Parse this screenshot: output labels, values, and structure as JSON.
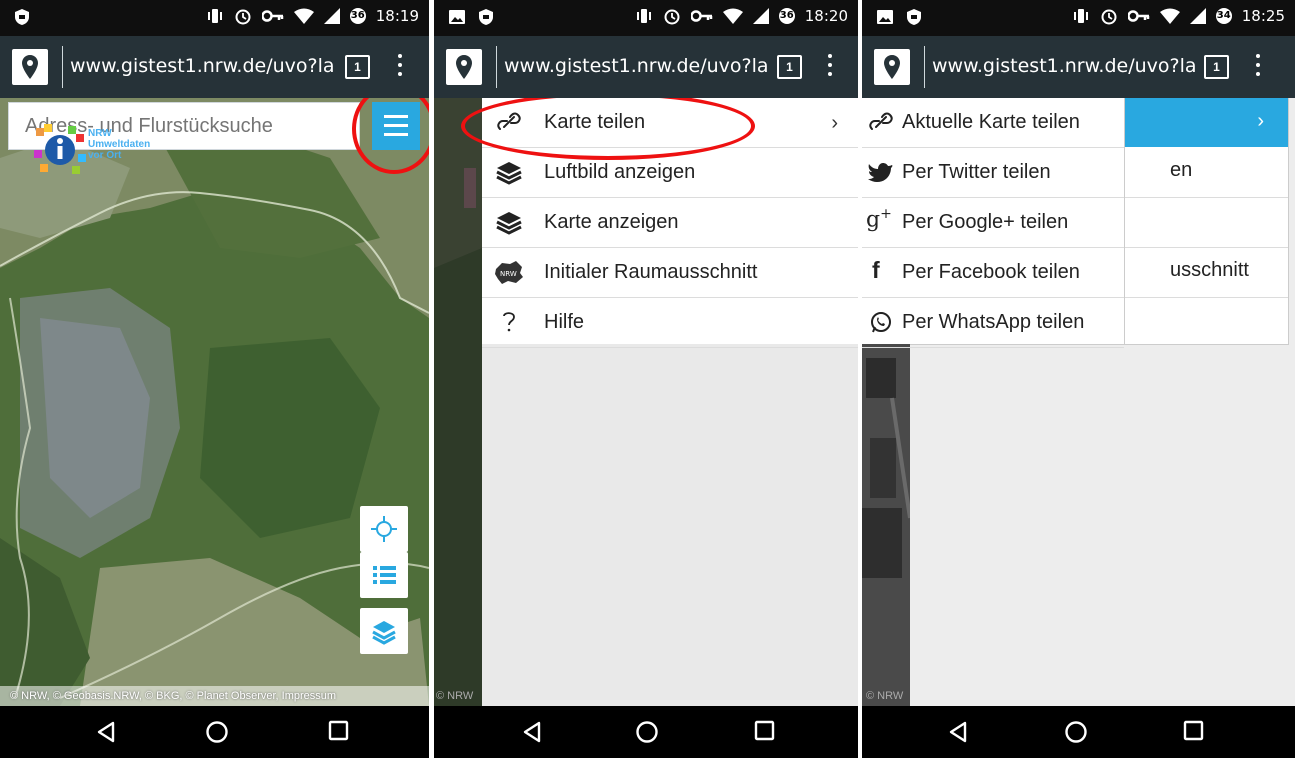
{
  "status_bars": {
    "panel1": {
      "time": "18:19",
      "battery": "36"
    },
    "panel2": {
      "time": "18:20",
      "battery": "36"
    },
    "panel3": {
      "time": "18:25",
      "battery": "34"
    }
  },
  "browser": {
    "url": "www.gistest1.nrw.de/uvo?la",
    "tab_count": "1"
  },
  "search": {
    "placeholder": "Adress- und Flurstücksuche"
  },
  "map": {
    "logo_label": "NRW Umweltdaten vor Ort",
    "attribution": "© NRW, © Geobasis.NRW, © BKG, © Planet Observer, Impressum",
    "attribution_short": "© NRW"
  },
  "menu": {
    "items": [
      {
        "label": "Karte teilen",
        "icon": "link-icon"
      },
      {
        "label": "Luftbild anzeigen",
        "icon": "layers-icon"
      },
      {
        "label": "Karte anzeigen",
        "icon": "layers-icon"
      },
      {
        "label": "Initialer Raumausschnitt",
        "icon": "nrw-shape-icon"
      },
      {
        "label": "Hilfe",
        "icon": "question-icon"
      }
    ]
  },
  "share_menu": {
    "items": [
      {
        "label": "Aktuelle Karte teilen",
        "icon": "link-icon"
      },
      {
        "label": "Per Twitter teilen",
        "icon": "twitter-icon"
      },
      {
        "label": "Per Google+ teilen",
        "icon": "google-plus-icon"
      },
      {
        "label": "Per Facebook teilen",
        "icon": "facebook-icon"
      },
      {
        "label": "Per WhatsApp teilen",
        "icon": "whatsapp-icon"
      }
    ],
    "behind_fragments": [
      "en",
      "usschnitt"
    ]
  },
  "colors": {
    "accent": "#29a8e0",
    "toolbar": "#263238",
    "highlight_circle": "#e11111"
  }
}
